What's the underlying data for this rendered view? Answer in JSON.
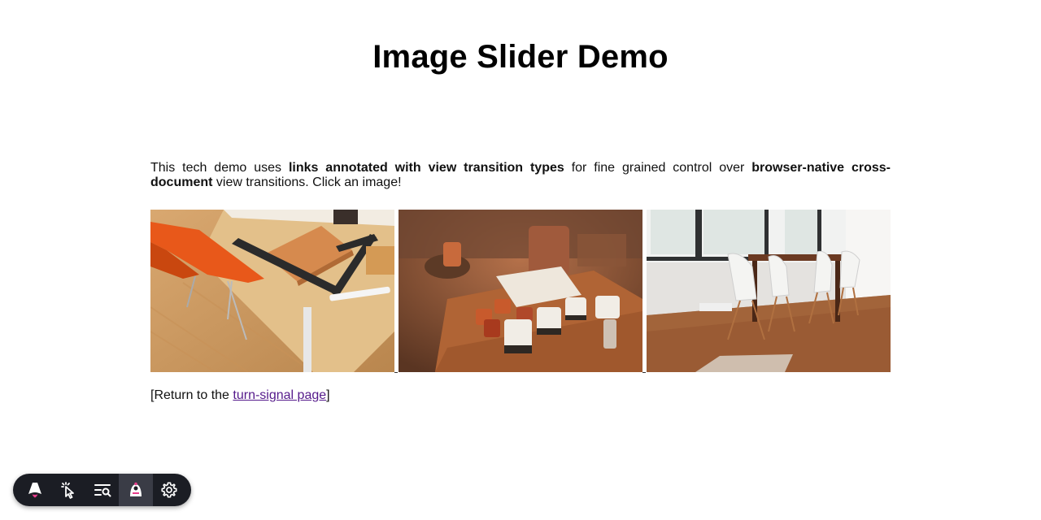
{
  "page": {
    "title": "Image Slider Demo"
  },
  "intro": {
    "part1": "This tech demo uses ",
    "bold1": "links annotated with view transition types",
    "part2": " for fine grained control over ",
    "bold2": "browser-native cross-document",
    "part3": " view transitions. Click an image!"
  },
  "gallery": {
    "images": [
      {
        "subject": "desk with orange chair, notebook and ruler"
      },
      {
        "subject": "wooden table with cups and teapot"
      },
      {
        "subject": "dining room with white chairs"
      }
    ]
  },
  "return_link": {
    "prefix": "[Return to the ",
    "link_text": "turn-signal page",
    "suffix": "]"
  },
  "toolbar": {
    "items": [
      {
        "icon": "astro-logo-icon",
        "active": false
      },
      {
        "icon": "cursor-inspect-icon",
        "active": false
      },
      {
        "icon": "audit-list-icon",
        "active": false
      },
      {
        "icon": "accessibility-icon",
        "active": true
      },
      {
        "icon": "gear-icon",
        "active": false
      }
    ]
  },
  "colors": {
    "link_visited": "#551a8b",
    "toolbar_bg": "#1b1d24",
    "astro_accent": "#e83e8c"
  }
}
